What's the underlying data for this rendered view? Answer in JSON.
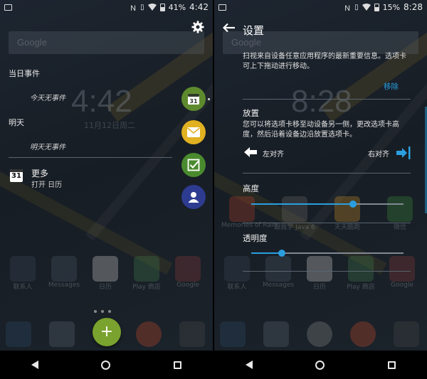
{
  "left_screen": {
    "status": {
      "battery": "41%",
      "time": "4:42"
    },
    "ghost": {
      "search": "Google",
      "clock": "4:42",
      "date": "11月12日周二",
      "dock_labels": [
        "联系人",
        "Messages",
        "日历",
        "Play 商店",
        "Google"
      ]
    },
    "calendar": {
      "today_header": "当日事件",
      "today_empty": "今天无事件",
      "tomorrow_header": "明天",
      "tomorrow_empty": "明天无事件",
      "more_icon_day": "31",
      "more_title": "更多",
      "more_subtitle": "打开 日历"
    },
    "bubbles": {
      "calendar_day": "31"
    },
    "fab_label": "+"
  },
  "right_screen": {
    "status": {
      "battery": "15%",
      "time": "8:28"
    },
    "ghost": {
      "search": "Google",
      "clock": "8:28",
      "app_labels": [
        "Memories of Rain",
        "跟我学 Java 6",
        "天天酷跑",
        "微信"
      ],
      "dock_labels": [
        "联系人",
        "Messages",
        "日历",
        "Play 商店",
        "Google"
      ]
    },
    "settings": {
      "title": "设置",
      "intro": "扫视来自设备任意应用程序的最新重要信息。选项卡可上下拖动进行移动。",
      "remove_link": "移除",
      "placement_heading": "放置",
      "placement_desc": "您可以将选项卡移至动设备另一侧，更改选项卡高度，然后沿着设备边沿放置选项卡。",
      "align_left": "左对齐",
      "align_right": "右对齐",
      "height_heading": "高度",
      "height_value": 0.67,
      "opacity_heading": "透明度",
      "opacity_value": 0.2
    }
  },
  "colors": {
    "accent_blue": "#2a9fe0",
    "calendar_green": "#5e8a2e",
    "mail_yellow": "#e0b121",
    "task_green": "#4a8a2e",
    "contact_blue": "#2d3c90",
    "fab_green": "#7aa22e"
  }
}
